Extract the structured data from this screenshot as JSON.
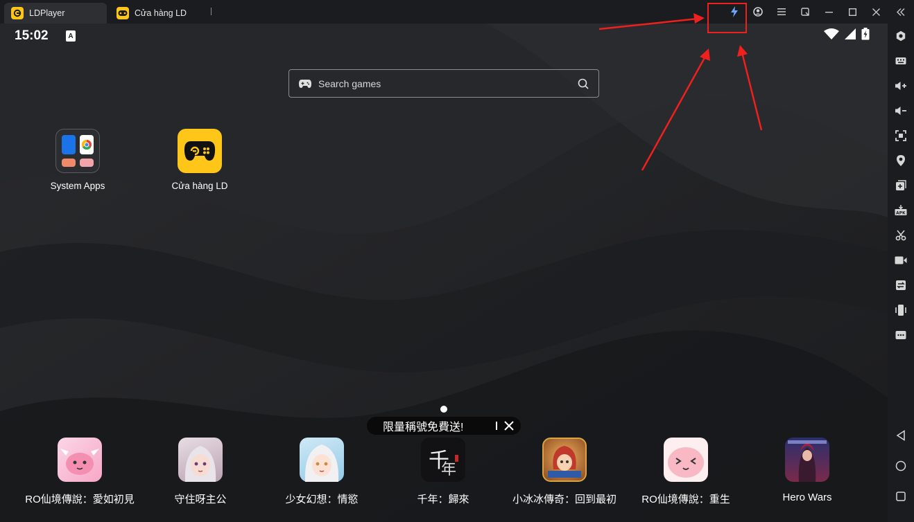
{
  "tabs": [
    {
      "label": "LDPlayer",
      "icon": "ldplayer-icon"
    },
    {
      "label": "Cửa hàng LD",
      "icon": "store-icon"
    }
  ],
  "window_buttons": [
    "lightning-icon",
    "account-icon",
    "menu-icon",
    "popout-icon",
    "minimize-icon",
    "maximize-icon",
    "close-icon",
    "collapse-icon"
  ],
  "status": {
    "time": "15:02",
    "keyboard_badge": "A"
  },
  "search": {
    "placeholder": "Search games"
  },
  "desktop_apps": [
    {
      "label": "System Apps",
      "icon": "folder-icon"
    },
    {
      "label": "Cửa hàng LD",
      "icon": "gamepad-icon"
    }
  ],
  "promo": {
    "text": "限量稱號免費送!"
  },
  "dock": [
    {
      "label": "RO仙境傳說：愛如初見",
      "color": "#f7c4d8"
    },
    {
      "label": "守住呀主公",
      "color": "#d9cbd6"
    },
    {
      "label": "少女幻想：情慾",
      "color": "#b7dcef"
    },
    {
      "label": "千年：歸來",
      "color": "#121214"
    },
    {
      "label": "小冰冰傳奇：回到最初",
      "color": "#c47a3a"
    },
    {
      "label": "RO仙境傳說：重生",
      "color": "#fbd3da"
    },
    {
      "label": "Hero Wars",
      "color": "#4a3a78"
    }
  ],
  "toolbar": [
    "settings-icon",
    "keyboard-icon",
    "volume-up-icon",
    "volume-down-icon",
    "fullscreen-icon",
    "location-icon",
    "add-window-icon",
    "apk-icon",
    "scissors-icon",
    "record-icon",
    "sync-icon",
    "shake-icon",
    "more-icon",
    "back-icon",
    "home-icon",
    "recents-icon"
  ],
  "colors": {
    "accent": "#ffc61a",
    "annotation": "#f0201e",
    "lightning": "#6aa8ff"
  }
}
